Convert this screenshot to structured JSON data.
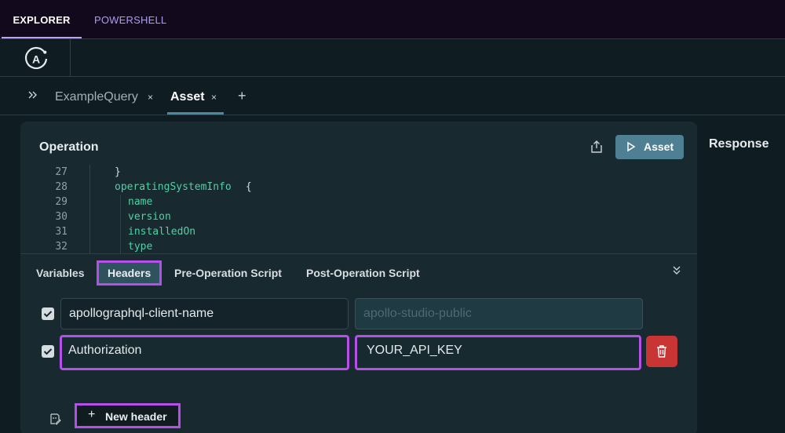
{
  "top_tabs": [
    {
      "label": "EXPLORER",
      "active": true
    },
    {
      "label": "POWERSHELL",
      "active": false
    }
  ],
  "logo": {
    "icon": "apollo-logo-icon"
  },
  "query_tabs": {
    "expand_icon": "double-chevron-right-icon",
    "items": [
      {
        "label": "ExampleQuery",
        "active": false
      },
      {
        "label": "Asset",
        "active": true
      }
    ],
    "close_label": "×",
    "add_label": "+"
  },
  "operation": {
    "title": "Operation",
    "run_button": "Asset",
    "share_icon": "share-icon",
    "keyboard_icon": "keyboard-icon",
    "code_lines": [
      {
        "num": "27",
        "text": "}",
        "color": "#d6dde0"
      },
      {
        "num": "28",
        "text": "operatingSystemInfo",
        "extra": " {",
        "color": "#4fd1a5"
      },
      {
        "num": "29",
        "text": "name",
        "color": "#4fd1a5"
      },
      {
        "num": "30",
        "text": "version",
        "color": "#4fd1a5"
      },
      {
        "num": "31",
        "text": "installedOn",
        "color": "#4fd1a5"
      },
      {
        "num": "32",
        "text": "type",
        "color": "#4fd1a5"
      }
    ]
  },
  "editor_tabs": {
    "items": [
      {
        "label": "Variables",
        "active": false
      },
      {
        "label": "Headers",
        "active": true
      },
      {
        "label": "Pre-Operation Script",
        "active": false
      },
      {
        "label": "Post-Operation Script",
        "active": false
      }
    ],
    "collapse_icon": "double-chevron-down-icon"
  },
  "headers": [
    {
      "key": "apollographql-client-name",
      "value": "apollo-studio-public",
      "checked": true,
      "value_disabled": true
    },
    {
      "key": "Authorization",
      "value": "YOUR_API_KEY",
      "checked": true,
      "value_disabled": false
    }
  ],
  "new_header": {
    "plus": "+",
    "label": "New header"
  },
  "response": {
    "title": "Response"
  },
  "colors": {
    "accent": "#4f7f93",
    "highlight": "#b44fe8",
    "delete": "#c93434",
    "code_field": "#4fd1a5"
  }
}
